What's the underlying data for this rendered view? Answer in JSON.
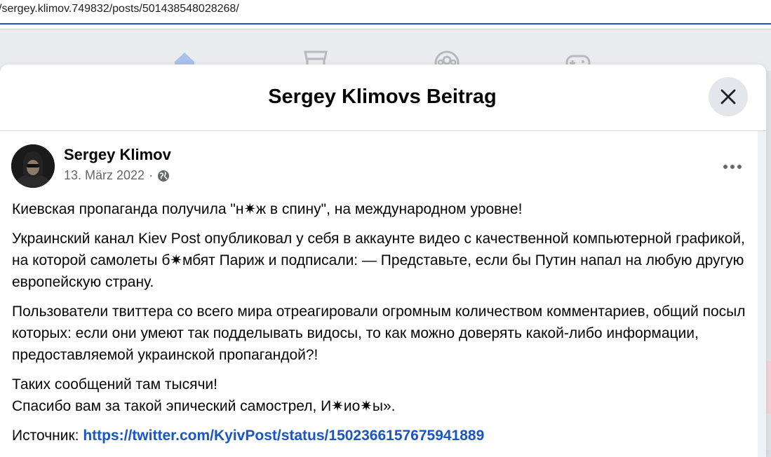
{
  "browser": {
    "url": "/sergey.klimov.749832/posts/501438548028268/"
  },
  "nav_icons": [
    "home-icon",
    "marketplace-icon",
    "groups-icon",
    "gaming-icon"
  ],
  "modal": {
    "title": "Sergey Klimovs Beitrag",
    "close_icon": "close-icon"
  },
  "post": {
    "author": "Sergey Klimov",
    "date": "13. März 2022",
    "separator": "·",
    "privacy_icon": "globe-icon",
    "more_icon": "more-options-icon",
    "paragraphs": [
      "Киевская пропаганда получила \"н✷ж в спину\", на международном уровне!",
      "Украинский канал Kiev Post опубликовал у себя в аккаунте видео с качественной компьютерной графикой, на которой самолеты б✷мбят Париж и подписали: — Представьте, если бы Путин напал на любую другую европейскую страну.",
      "Пользователи твиттера со всего мира отреагировали огромным количеством комментариев, общий посыл которых: если они умеют так подделывать видосы, то как можно доверять какой-либо информации, предоставляемой украинской пропагандой?!"
    ],
    "closing_line_1": "Таких сообщений там тысячи!",
    "closing_line_2": "Спасибо вам за такой эпический самострел, И✷ио✷ы».",
    "source_label": "Источник: ",
    "source_link": "https://twitter.com/KyivPost/status/1502366157675941889"
  },
  "colors": {
    "link": "#1a55c4",
    "address_underline": "#1a57c7",
    "close_bg": "#e4e6eb",
    "meta_text": "#65676b"
  }
}
